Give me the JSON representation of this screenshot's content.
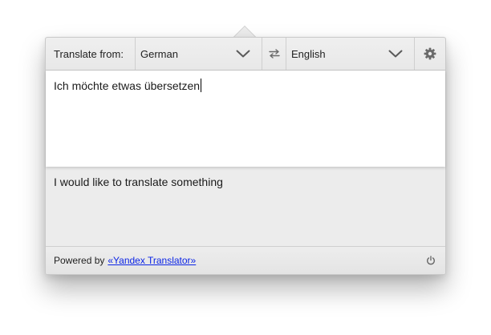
{
  "toolbar": {
    "from_label": "Translate from:",
    "source_language": "German",
    "target_language": "English",
    "swap_icon": "swap-arrows-icon",
    "settings_icon": "gear-icon",
    "chevron_icon": "chevron-down-icon"
  },
  "source": {
    "text": "Ich möchte etwas übersetzen"
  },
  "result": {
    "text": "I would like to translate something"
  },
  "footer": {
    "powered_by": "Powered by",
    "link_text": "«Yandex Translator»",
    "power_icon": "power-icon"
  },
  "colors": {
    "link": "#0b24e6",
    "panel_bg": "#ececec",
    "text_area_bg": "#ffffff"
  }
}
